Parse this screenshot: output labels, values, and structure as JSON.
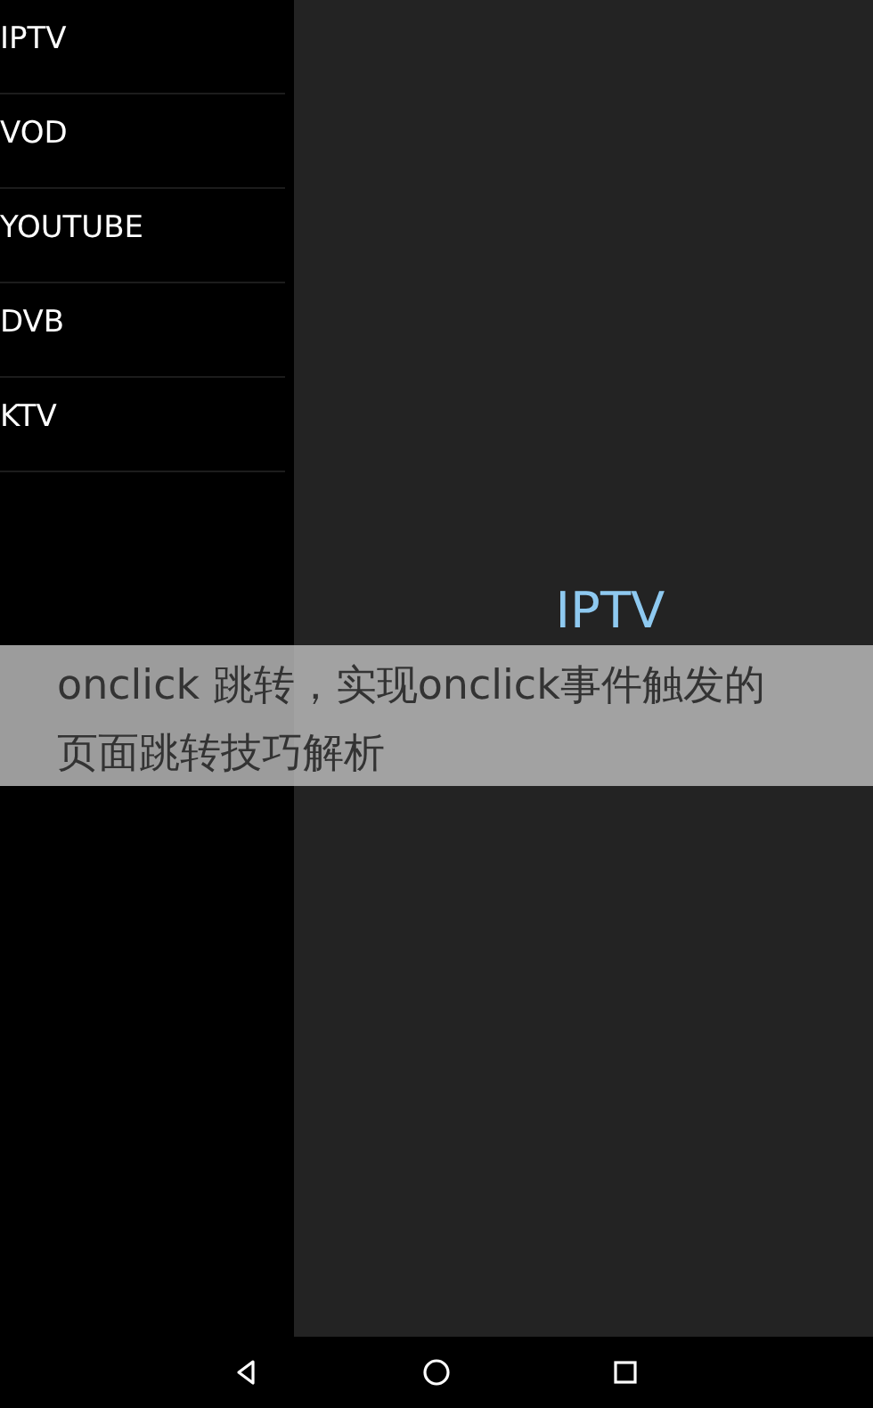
{
  "sidebar": {
    "items": [
      {
        "label": "IPTV"
      },
      {
        "label": "VOD"
      },
      {
        "label": "YOUTUBE"
      },
      {
        "label": "DVB"
      },
      {
        "label": "KTV"
      }
    ]
  },
  "content": {
    "title": "IPTV"
  },
  "caption_banner": {
    "text": "onclick 跳转，实现onclick事件触发的页面跳转技巧解析"
  },
  "nav_bar": {
    "buttons": [
      {
        "kind": "back"
      },
      {
        "kind": "home"
      },
      {
        "kind": "recents"
      }
    ]
  }
}
